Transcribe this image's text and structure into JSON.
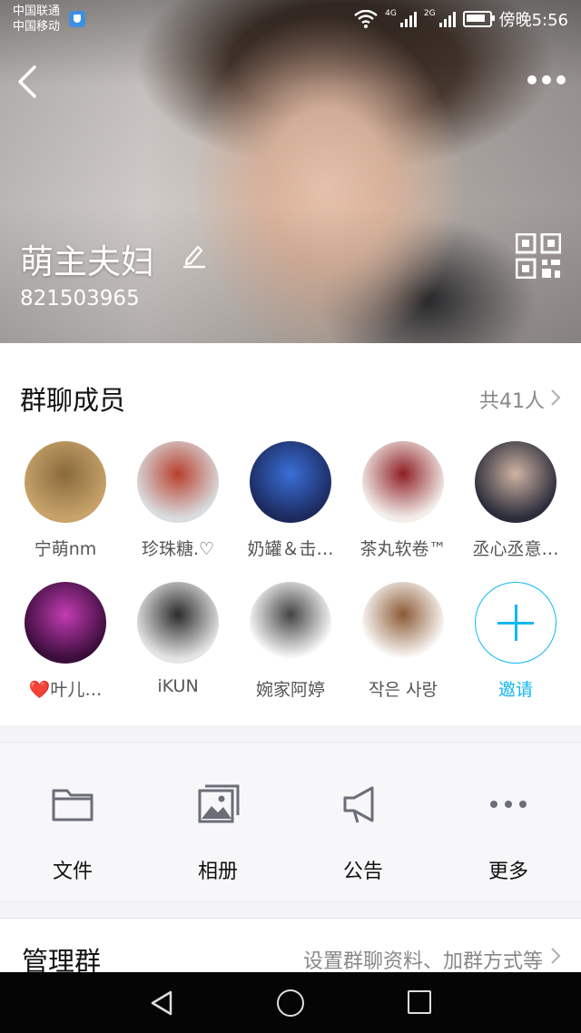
{
  "status_bar": {
    "carrier_1": "中国联通",
    "carrier_2": "中国移动",
    "net_1": "4G",
    "net_2": "2G",
    "time": "傍晚5:56"
  },
  "header": {
    "group_name": "萌主夫妇",
    "group_id": "821503965"
  },
  "members": {
    "title": "群聊成员",
    "count": "共41人",
    "items": [
      {
        "name": "宁萌nm",
        "avatar_colors": [
          "#c7a36a",
          "#8a6a3c"
        ]
      },
      {
        "name": "珍珠糖.♡",
        "avatar_colors": [
          "#d9dde0",
          "#b8402e"
        ]
      },
      {
        "name": "奶罐＆击…",
        "avatar_colors": [
          "#1c2a5e",
          "#3b6fd8"
        ]
      },
      {
        "name": "茶丸软卷™",
        "avatar_colors": [
          "#f3eeea",
          "#8e1f26"
        ]
      },
      {
        "name": "丞心丞意…",
        "avatar_colors": [
          "#2a2c3a",
          "#cfb3a3"
        ]
      },
      {
        "name": "❤️叶儿…",
        "avatar_colors": [
          "#3a0d3a",
          "#c23cb4"
        ]
      },
      {
        "name": "iKUN",
        "avatar_colors": [
          "#e5e5e5",
          "#2c2c2c"
        ]
      },
      {
        "name": "婉家阿婷",
        "avatar_colors": [
          "#ffffff",
          "#444444"
        ]
      },
      {
        "name": "작은 사랑",
        "avatar_colors": [
          "#ffffff",
          "#8b5a35"
        ]
      }
    ],
    "invite_label": "邀请"
  },
  "actions": [
    {
      "label": "文件",
      "icon": "folder-icon"
    },
    {
      "label": "相册",
      "icon": "album-icon"
    },
    {
      "label": "公告",
      "icon": "megaphone-icon"
    },
    {
      "label": "更多",
      "icon": "more-icon"
    }
  ],
  "manage": {
    "title": "管理群",
    "description": "设置群聊资料、加群方式等"
  },
  "colors": {
    "accent": "#12b7f5",
    "icon_gray": "#6b6e78"
  }
}
